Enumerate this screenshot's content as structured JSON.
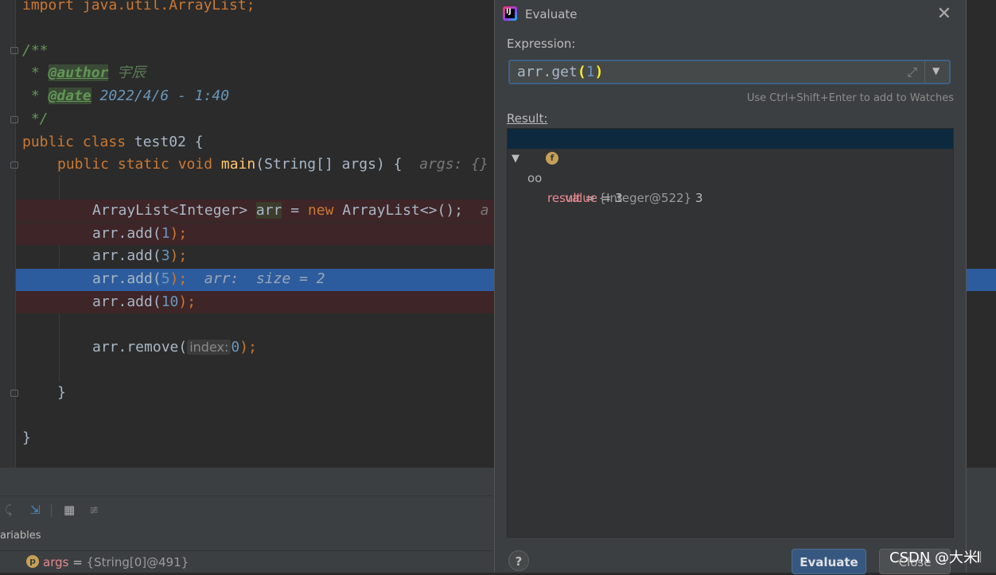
{
  "editor": {
    "line_import": "import java.util.ArrayList;",
    "doc_open": "/**",
    "doc_star1": " * ",
    "author_tag": "@author",
    "author_value": " 宇辰",
    "doc_star2": " * ",
    "date_tag": "@date",
    "date_value": " 2022/4/6 - 1:40",
    "doc_close": " */",
    "class_kw": "public class",
    "class_name": " test02 {",
    "main_kw": "public static void",
    "main_name": " main",
    "main_params": "(String[] args) {",
    "main_hint": "args: {}",
    "decl_type": "ArrayList<Integer> ",
    "decl_var": "arr",
    "decl_eq": " = ",
    "decl_new": "new",
    "decl_rest": " ArrayList<>();",
    "decl_hint": "a",
    "add1_pre": "arr.add(",
    "add1_num": "1",
    "add1_post": ");",
    "add3_pre": "arr.add(",
    "add3_num": "3",
    "add3_post": ");",
    "add5_pre": "arr.add(",
    "add5_num": "5",
    "add5_post": ");",
    "add5_hint": "arr:  size = 2",
    "add10_pre": "arr.add(",
    "add10_num": "10",
    "add10_post": ");",
    "remove_pre": "arr.remove(",
    "remove_param": "index:",
    "remove_num": "0",
    "remove_post": ");",
    "close_method": "}",
    "close_class": "}"
  },
  "debugger": {
    "tab_label": "ariables",
    "var_name": "args",
    "var_eq": " = ",
    "var_value": "{String[0]@491}",
    "var_badge": "p",
    "toolbar_icons": [
      "restore-layout-icon",
      "step-into-icon",
      "table-icon",
      "settings-lines-icon"
    ]
  },
  "dialog": {
    "title": "Evaluate",
    "close": "✕",
    "expression_label": "Expression:",
    "expression_prefix": "arr.get",
    "expression_open": "(",
    "expression_arg": "1",
    "expression_close": ")",
    "watch_hint": "Use Ctrl+Shift+Enter to add to Watches",
    "result_label": "Result:",
    "result_name": "result",
    "result_eq": " = ",
    "result_type": "{Integer@522}",
    "result_value": " 3",
    "field_badge": "f",
    "field_name": "value",
    "field_eq": " = 3",
    "help": "?",
    "evaluate_button": "Evaluate",
    "close_button": "Close"
  },
  "watermark": "CSDN @大米𝄃"
}
